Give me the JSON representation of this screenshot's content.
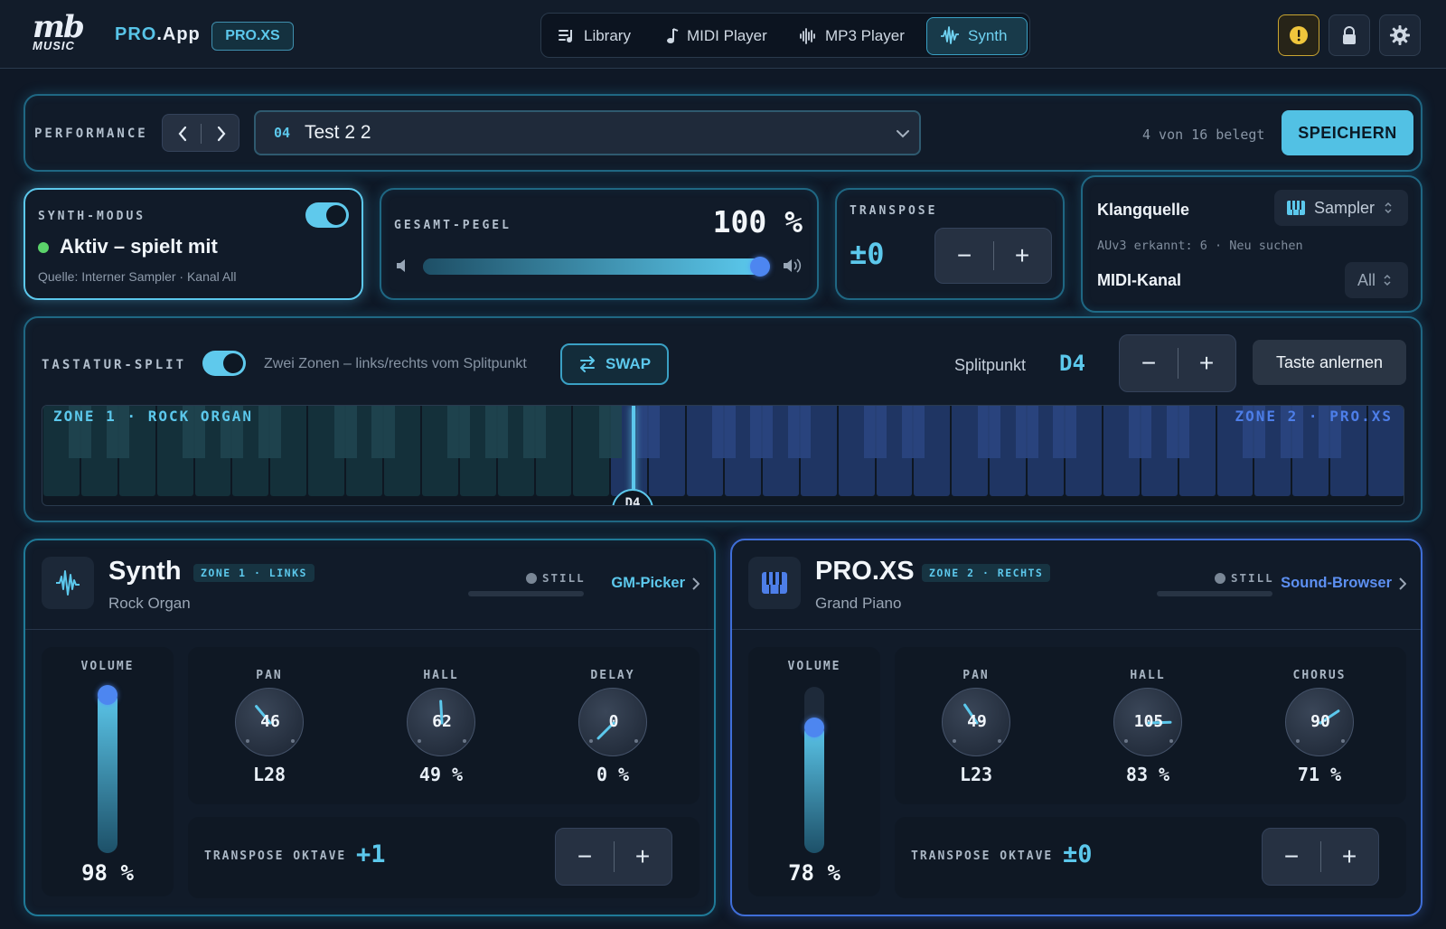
{
  "header": {
    "logo_mb": "mb",
    "logo_music": "MUSIC",
    "app_name_pro": "PRO",
    "app_name_rest": ".App",
    "app_badge": "PRO.XS",
    "tabs": [
      {
        "label": "Library",
        "icon": "library-icon",
        "active": false
      },
      {
        "label": "MIDI Player",
        "icon": "music-note-icon",
        "active": false
      },
      {
        "label": "MP3 Player",
        "icon": "waveform-icon",
        "active": false
      },
      {
        "label": "Synth",
        "icon": "synth-wave-icon",
        "active": true
      }
    ],
    "right_icons": [
      "warning-icon",
      "lock-icon",
      "gear-icon"
    ]
  },
  "performance": {
    "label": "PERFORMANCE",
    "preset_number": "04",
    "preset_name": "Test 2 2",
    "slots_info": "4 von 16 belegt",
    "save_label": "SPEICHERN"
  },
  "synth_mode": {
    "label": "SYNTH-MODUS",
    "status": "Aktiv – spielt mit",
    "source": "Quelle: Interner Sampler · Kanal All",
    "enabled": true
  },
  "master_level": {
    "label": "GESAMT-PEGEL",
    "value_text": "100 %",
    "level": 1.0
  },
  "transpose": {
    "label": "TRANSPOSE",
    "value": "±0"
  },
  "sound_source": {
    "klangquelle_label": "Klangquelle",
    "klangquelle_value": "Sampler",
    "auv3_info": "AUv3 erkannt: 6 · Neu suchen",
    "midi_channel_label": "MIDI-Kanal",
    "midi_channel_value": "All"
  },
  "split": {
    "label": "TASTATUR-SPLIT",
    "enabled": true,
    "description": "Zwei Zonen – links/rechts vom Splitpunkt",
    "swap_label": "SWAP",
    "splitpoint_label": "Splitpunkt",
    "splitpoint_value": "D4",
    "learn_label": "Taste anlernen",
    "zone1_label": "ZONE 1 · ROCK ORGAN",
    "zone2_label": "ZONE 2 · PRO.XS",
    "marker": "D4"
  },
  "zones": [
    {
      "title": "Synth",
      "tag": "ZONE 1 · LINKS",
      "subtitle": "Rock Organ",
      "status": "STILL",
      "link": "GM-Picker",
      "icon": "synth-wave-icon",
      "volume_label": "VOLUME",
      "volume_text": "98 %",
      "volume": 0.98,
      "knobs": [
        {
          "label": "PAN",
          "inner": "46",
          "value": "L28"
        },
        {
          "label": "HALL",
          "inner": "62",
          "value": "49 %"
        },
        {
          "label": "DELAY",
          "inner": "0",
          "value": "0 %"
        }
      ],
      "transpose_label": "TRANSPOSE OKTAVE",
      "transpose_value": "+1"
    },
    {
      "title": "PRO.XS",
      "tag": "ZONE 2 · RECHTS",
      "subtitle": "Grand Piano",
      "status": "STILL",
      "link": "Sound-Browser",
      "icon": "piano-icon",
      "volume_label": "VOLUME",
      "volume_text": "78 %",
      "volume": 0.78,
      "knobs": [
        {
          "label": "PAN",
          "inner": "49",
          "value": "L23"
        },
        {
          "label": "HALL",
          "inner": "105",
          "value": "83 %"
        },
        {
          "label": "CHORUS",
          "inner": "90",
          "value": "71 %"
        }
      ],
      "transpose_label": "TRANSPOSE OKTAVE",
      "transpose_value": "±0"
    }
  ],
  "colors": {
    "accent": "#5cc8ec",
    "zone2_accent": "#4d7ee8",
    "background": "#0f1826",
    "active_green": "#5bd36a",
    "warning": "#f0c63c"
  }
}
